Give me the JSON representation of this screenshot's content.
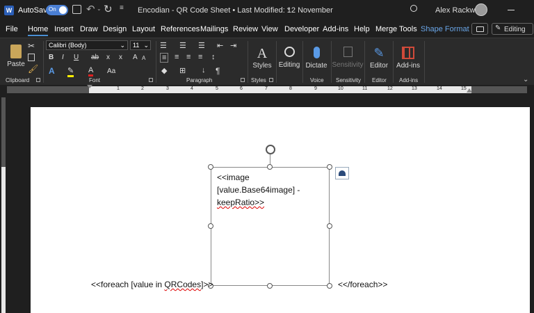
{
  "titlebar": {
    "autosave_label": "AutoSave",
    "autosave_state": "On",
    "doc_title": "Encodian - QR Code Sheet • Last Modified: 12 November",
    "user_name": "Alex Rackwitz",
    "title_chevron": "⌄"
  },
  "menu": {
    "tabs": [
      "File",
      "Home",
      "Insert",
      "Draw",
      "Design",
      "Layout",
      "References",
      "Mailings",
      "Review",
      "View",
      "Developer",
      "Add-ins",
      "Help",
      "Merge Tools",
      "Shape Format"
    ],
    "editing_label": "Editing"
  },
  "ribbon": {
    "paste": "Paste",
    "font_name": "Calibri (Body)",
    "font_size": "11",
    "groups": {
      "clipboard": "Clipboard",
      "font": "Font",
      "paragraph": "Paragraph",
      "styles": "Styles",
      "voice": "Voice",
      "sensitivity": "Sensitivity",
      "editor": "Editor",
      "addins": "Add-ins"
    },
    "buttons": {
      "styles": "Styles",
      "editing": "Editing",
      "dictate": "Dictate",
      "sensitivity": "Sensitivity",
      "editor": "Editor",
      "addins": "Add-ins"
    },
    "font_buttons": {
      "bold": "B",
      "italic": "I",
      "underline": "U",
      "strike": "ab",
      "subscript": "x",
      "superscript": "x",
      "font_color": "A",
      "case": "Aa",
      "grow": "A",
      "shrink": "A"
    },
    "pilcrow": "¶"
  },
  "ruler": {
    "numbers": [
      "1",
      "2",
      "3",
      "4",
      "5",
      "6",
      "7",
      "8",
      "9",
      "10",
      "11",
      "12",
      "13",
      "14",
      "15"
    ]
  },
  "document": {
    "image_line1": "<<image",
    "image_line2": "[value.Base64image] -",
    "image_line3": "keepRatio>>",
    "foreach_open": "<<foreach [value in ",
    "foreach_qr": "QRCodes",
    "foreach_close_part": "]>>",
    "foreach_end": "<</foreach>>"
  }
}
